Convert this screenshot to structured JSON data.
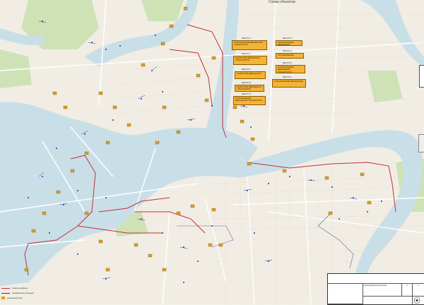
{
  "title": "Схема объектов",
  "callouts": [
    {
      "head": "МЕСТО 1",
      "text": "ОГРАНИЧЕНИЕ ДВИЖЕНИЯ ТРАНСПОРТА"
    },
    {
      "head": "МЕСТО 2",
      "text": "ОГРАНИЧЕНИЕ ДВИЖЕНИЯ"
    },
    {
      "head": "МЕСТО 3",
      "text": "ЗАКРЫТИЕ ДВИЖЕНИЯ ТРАНСПОРТА"
    },
    {
      "head": "МЕСТО 4",
      "text": "ОГРАНИЧЕНИЕ"
    },
    {
      "head": "МЕСТО 5",
      "text": "ОГРАНИЧЕНИЕ ДВИЖЕНИЯ ТРАНСПОРТА"
    },
    {
      "head": "МЕСТО 6",
      "text": "ЗАКРЫТИЕ ДВИЖЕНИЯ"
    },
    {
      "head": "МЕСТО 7",
      "text": "ОГРАНИЧЕНИЕ ДВИЖЕНИЯ"
    },
    {
      "head": "МЕСТО 8",
      "text": "ЗАКРЫТИЕ ДВИЖЕНИЯ ТРАНСПОРТА"
    },
    {
      "head": "МЕСТО 9",
      "text": "ОГРАНИЧЕНИЕ ДВИЖЕНИЯ ТРАНСПОРТА"
    }
  ],
  "legend": {
    "items": [
      {
        "label": "граница района",
        "color": "#c0303a"
      },
      {
        "label": "направление объезда",
        "color": "#2233aa"
      },
      {
        "label": "дорожный знак",
        "color": "#e0a020"
      }
    ]
  },
  "stamp": {
    "caption": "Схема маршрутов объезда",
    "sheet": "1",
    "sheets": "1"
  },
  "colors": {
    "water": "#c9dfe8",
    "land": "#f1ede4",
    "park": "#cfe2b6",
    "road": "#ffffff",
    "boundary": "#c0303a",
    "sign": "#e0a020",
    "route": "#2233aa"
  }
}
